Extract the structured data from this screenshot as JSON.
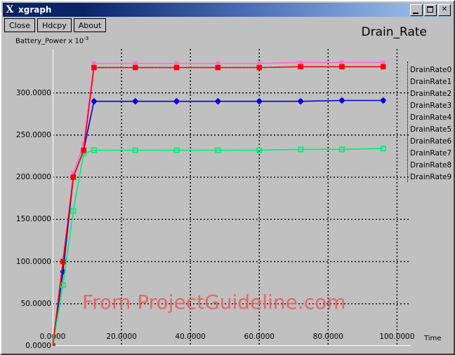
{
  "window": {
    "title": "xgraph",
    "logo_glyph": "X",
    "buttons": [
      {
        "name": "minimize-button",
        "label": "_"
      },
      {
        "name": "maximize-button",
        "label": "□"
      },
      {
        "name": "close-button",
        "label": "✕"
      }
    ]
  },
  "toolbar": {
    "close_label": "Close",
    "hdcpy_label": "Hdcpy",
    "about_label": "About"
  },
  "watermark": "From ProjectGuideline.com",
  "chart_data": {
    "type": "line",
    "title": "Drain_Rate",
    "xlabel": "Time",
    "ylabel": "Battery_Power x 10",
    "ylabel_exponent": "-3",
    "xlim": [
      0,
      104
    ],
    "ylim": [
      0,
      352
    ],
    "xticks": [
      0,
      20,
      40,
      60,
      80,
      100
    ],
    "xtick_labels": [
      "0.0000",
      "20.0000",
      "40.0000",
      "60.0000",
      "80.0000",
      "100.0000"
    ],
    "yticks": [
      0,
      50,
      100,
      150,
      200,
      250,
      300
    ],
    "ytick_labels": [
      "0.0000",
      "50.0000",
      "100.0000",
      "150.0000",
      "200.0000",
      "250.0000",
      "300.0000"
    ],
    "grid": true,
    "grid_style": "dotted",
    "legend_position": "right-outside",
    "x": [
      0,
      3,
      6,
      9,
      12,
      24,
      36,
      48,
      60,
      72,
      84,
      96
    ],
    "series": [
      {
        "name": "DrainRate0",
        "color": "#ff0000",
        "marker": "filled-square",
        "dash": "solid",
        "values": [
          0,
          100,
          200,
          232,
          330,
          330,
          330,
          330,
          330,
          331,
          331,
          331
        ]
      },
      {
        "name": "DrainRate1",
        "color": "#00ee76",
        "marker": "open-square",
        "dash": "solid",
        "values": [
          0,
          72,
          160,
          228,
          232,
          232,
          232,
          232,
          232,
          233,
          233,
          234
        ]
      },
      {
        "name": "DrainRate2",
        "color": "#0000ee",
        "marker": "filled-circle",
        "dash": "solid",
        "values": [
          0,
          88,
          200,
          232,
          290,
          290,
          290,
          290,
          290,
          290,
          291,
          291
        ]
      },
      {
        "name": "DrainRate3",
        "color": "#ffff00",
        "marker": "cross-x",
        "dash": "solid",
        "values": [
          0,
          88,
          200,
          232,
          290,
          290,
          290,
          290,
          290,
          290,
          291,
          291
        ]
      },
      {
        "name": "DrainRate4",
        "color": "#9b30ff",
        "marker": "diamond",
        "dash": "solid",
        "values": [
          0,
          88,
          200,
          232,
          290,
          290,
          290,
          290,
          290,
          290,
          291,
          291
        ]
      },
      {
        "name": "DrainRate5",
        "color": "#ffa500",
        "marker": "plus",
        "dash": "solid",
        "values": [
          0,
          88,
          200,
          232,
          290,
          290,
          290,
          290,
          290,
          290,
          291,
          291
        ]
      },
      {
        "name": "DrainRate6",
        "color": "#ff69d4",
        "marker": "star",
        "dash": "solid",
        "values": [
          0,
          100,
          205,
          240,
          335,
          335,
          335,
          335,
          335,
          336,
          336,
          336
        ]
      },
      {
        "name": "DrainRate7",
        "color": "#00ffff",
        "marker": "plus",
        "dash": "solid",
        "values": [
          0,
          88,
          200,
          232,
          290,
          290,
          290,
          290,
          290,
          290,
          291,
          291
        ]
      },
      {
        "name": "DrainRate8",
        "color": "#ff0000",
        "marker": "filled-square",
        "dash": "dotted",
        "values": [
          0,
          100,
          200,
          232,
          330,
          330,
          330,
          330,
          330,
          331,
          331,
          331
        ]
      },
      {
        "name": "DrainRate9",
        "color": "#00ee76",
        "marker": "open-square",
        "dash": "dotted",
        "values": [
          0,
          72,
          160,
          228,
          232,
          232,
          232,
          232,
          232,
          233,
          233,
          234
        ]
      }
    ]
  }
}
